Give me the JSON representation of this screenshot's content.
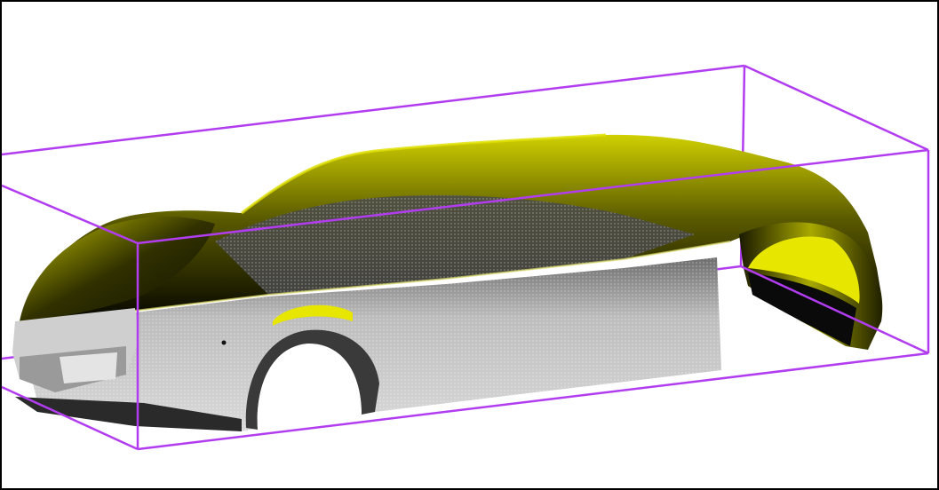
{
  "scene": {
    "subject": "car-body-point-cloud",
    "colors": {
      "background": "#ffffff",
      "frame_border": "#000000",
      "bounding_box": "#b23cf0",
      "body_highlight": "#d8d800",
      "body_dark": "#0a0a00",
      "body_side": "#c8c8c8",
      "wheel_well_inner": "#e6e600"
    }
  }
}
